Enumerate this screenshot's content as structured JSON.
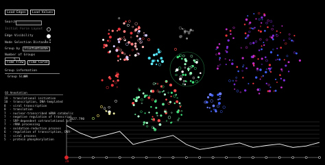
{
  "toolbar": {
    "load_edges": "Load Edges",
    "load_values": "Load Values"
  },
  "controls": {
    "search_label": "Search",
    "search_value": "",
    "initial_force_layout_label": "Initial Force Layout",
    "edge_visibility_label": "Edge Visibility",
    "node_selection_distance_label": "Node Selection Distance",
    "node_selection_distance_value": "1",
    "group_by_label": "Group by",
    "group_by_value": "FluctuationV",
    "number_of_groups_label": "Number of Groups",
    "number_of_groups_value": "5",
    "time_flow_label": "Time Flow",
    "time_curve_label": "Time Curve"
  },
  "group_info": {
    "heading": "Group information",
    "group_size_label": "Group Size:",
    "group_size_value": "89"
  },
  "go_annotation": {
    "heading": "GO Annotation",
    "items": [
      {
        "count": "19",
        "term": "- translational initiation"
      },
      {
        "count": "10",
        "term": "- transcription, DNA-templated"
      },
      {
        "count": "8",
        "term": "- viral transcription"
      },
      {
        "count": "8",
        "term": "- translation"
      },
      {
        "count": "7",
        "term": "- nuclear-transcribed mRNA catabolic"
      },
      {
        "count": "7",
        "term": "- negative regulation of transcript"
      },
      {
        "count": "7",
        "term": "- SRP-dependent cotranslational pro"
      },
      {
        "count": "7",
        "term": "- rRNA processing"
      },
      {
        "count": "6",
        "term": "- oxidation-reduction process"
      },
      {
        "count": "6",
        "term": "- regulation of transcription, DNA-"
      },
      {
        "count": "5",
        "term": "- viral process"
      },
      {
        "count": "5",
        "term": "- protein phosphorylation"
      }
    ]
  },
  "timeline": {
    "value_label": "1027.790",
    "current_step": "20",
    "step_count": 20
  },
  "colors": {
    "accent": "#e0242a",
    "line": "#ffffff",
    "node_red": "#e8323a",
    "node_green": "#3fe07a",
    "node_cyan": "#45d8ea",
    "node_magenta": "#c02cc8",
    "node_blue": "#3d5cf0"
  },
  "chart_data": {
    "type": "line",
    "x": [
      1,
      2,
      3,
      4,
      5,
      6,
      7,
      8,
      9,
      10,
      11,
      12,
      13,
      14,
      15,
      16,
      17,
      18,
      19,
      20
    ],
    "values": [
      1027.79,
      1013,
      1003,
      1009,
      1016,
      990,
      997,
      1002,
      1008,
      990,
      980,
      984,
      989,
      993,
      984,
      988,
      991,
      984,
      987,
      994
    ],
    "ylim": [
      975,
      1035
    ]
  }
}
